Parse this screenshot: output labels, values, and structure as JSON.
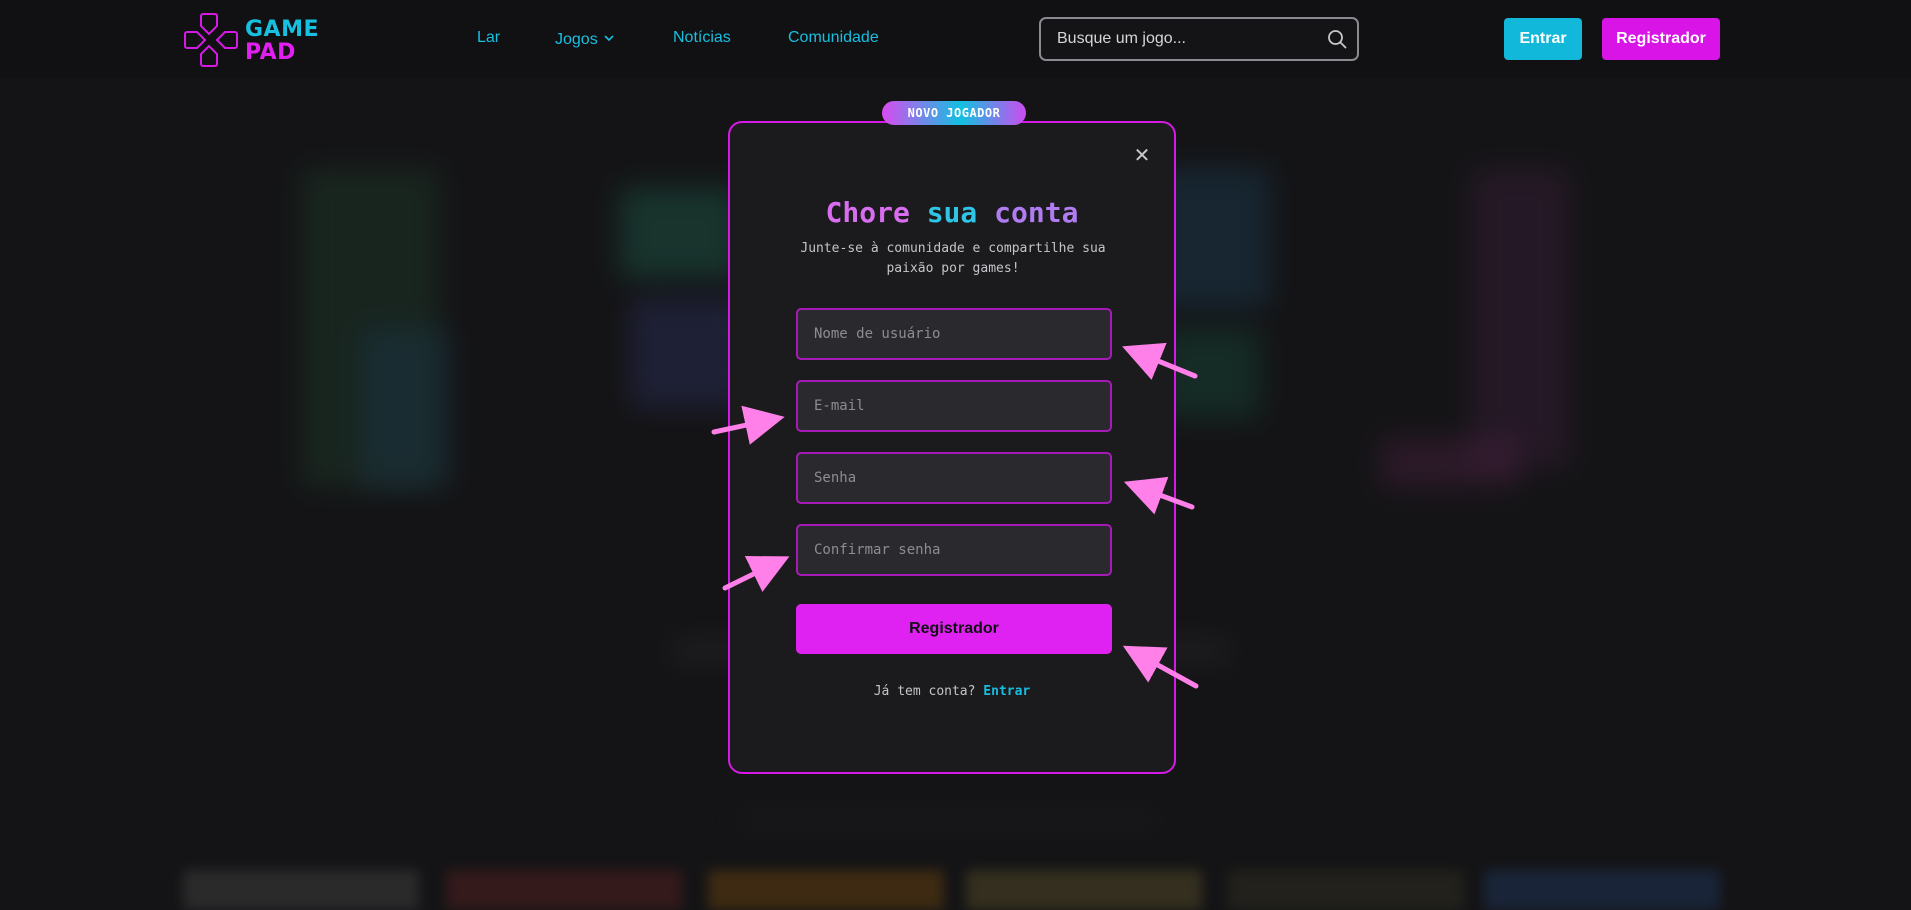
{
  "header": {
    "logo": {
      "line1": "GAME",
      "line2": "PAD"
    },
    "nav": [
      {
        "label": "Lar"
      },
      {
        "label": "Jogos",
        "has_dropdown": true
      },
      {
        "label": "Notícias"
      },
      {
        "label": "Comunidade"
      }
    ],
    "search": {
      "placeholder": "Busque um jogo...",
      "icon": "search-icon"
    },
    "login_label": "Entrar",
    "register_label": "Registrador"
  },
  "modal": {
    "badge": "NOVO JOGADOR",
    "title_part1": "Chore",
    "title_part2": "sua",
    "title_part3": "conta",
    "subtitle": "Junte-se à comunidade e compartilhe sua paixão por games!",
    "fields": {
      "username_placeholder": "Nome de usuário",
      "email_placeholder": "E-mail",
      "password_placeholder": "Senha",
      "confirm_placeholder": "Confirmar senha"
    },
    "submit_label": "Registrador",
    "login_prompt": "Já tem conta?",
    "login_link": "Entrar",
    "close_icon": "close-icon"
  },
  "colors": {
    "background": "#141416",
    "cyan_accent": "#12b8da",
    "magenta_accent": "#df22f1",
    "annotation_arrow": "#ff80e8"
  }
}
